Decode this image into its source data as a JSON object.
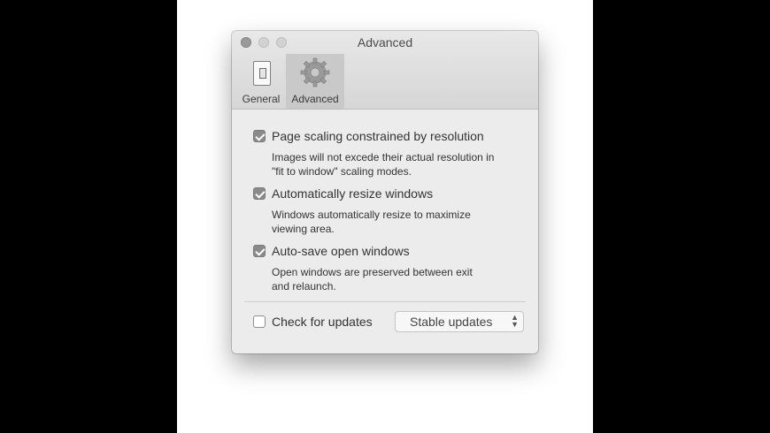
{
  "window": {
    "title": "Advanced"
  },
  "tabs": [
    {
      "label": "General",
      "icon": "switch-icon"
    },
    {
      "label": "Advanced",
      "icon": "gear-icon",
      "selected": true
    }
  ],
  "options": [
    {
      "label": "Page scaling constrained by resolution",
      "checked": true,
      "description": "Images will not excede their actual resolution in\n\"fit to window\" scaling modes."
    },
    {
      "label": "Automatically resize windows",
      "checked": true,
      "description": "Windows automatically resize to maximize\nviewing area."
    },
    {
      "label": "Auto-save open windows",
      "checked": true,
      "description": "Open windows are preserved between exit\nand relaunch."
    }
  ],
  "updates": {
    "check_label": "Check for updates",
    "checked": false,
    "selected_channel": "Stable updates"
  },
  "colors": {
    "window_bg": "#ececec",
    "checkbox_checked": "#8a8a8a"
  }
}
